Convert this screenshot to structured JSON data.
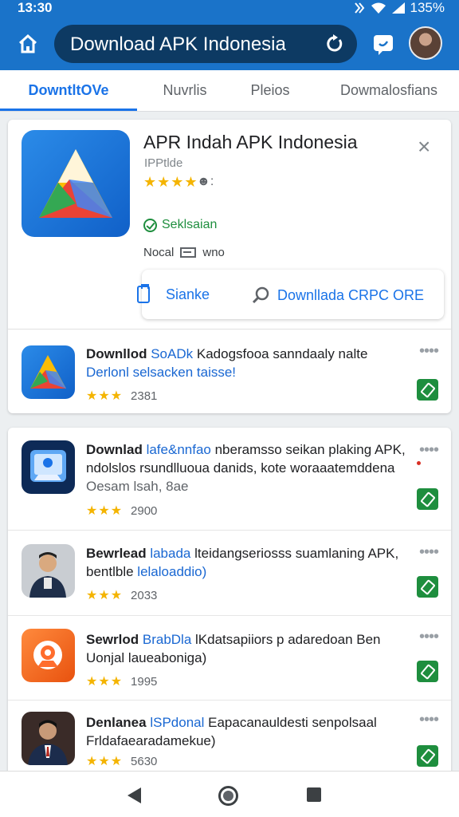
{
  "status_bar": {
    "time": "13:30",
    "battery": "135%"
  },
  "app_bar": {
    "search_text": "Download APK Indonesia"
  },
  "tabs": [
    {
      "label": "DowntltOVe",
      "active": true
    },
    {
      "label": "Nuvrlis",
      "active": false
    },
    {
      "label": "Pleios",
      "active": false
    },
    {
      "label": "Dowmalosfians",
      "active": false
    }
  ],
  "featured": {
    "title": "APR Indah APK Indonesia",
    "subtitle": "IPPtlde",
    "stars": "★★★★",
    "status": "Seklsaian",
    "meta_label": "Nocal",
    "meta_value": "wno",
    "action_left": "Sianke",
    "action_right": "Downllada CRPC ORE"
  },
  "apps": [
    {
      "title_bold": "Downllod",
      "title_blue": "SoADk",
      "title_rest": " Kadogsfooa sanndaaly nalte",
      "line2_blue": "Derlonl selsacken taisse!",
      "line3": "",
      "stars": "★★★",
      "count": "2381",
      "icon": "gradient-triangle-icon"
    },
    {
      "title_bold": "Downlad",
      "title_blue": "lafe&nnfao",
      "title_rest": " nberamsso seikan plaking APK, ndolslos rsundlluoua danids, kote woraaatemddena",
      "line2_blue": "",
      "line3": "Oesam lsah, 8ae",
      "stars": "★★★",
      "count": "2900",
      "icon": "phone-app-icon"
    },
    {
      "title_bold": "Bewrlead",
      "title_blue": "labada",
      "title_rest": " lteidangseriosss suamlaning APK, bentlble",
      "line2_blue": "lelaloaddio)",
      "line3": "",
      "stars": "★★★",
      "count": "2033",
      "icon": "person-icon"
    },
    {
      "title_bold": "Sewrlod",
      "title_blue": "BrabDla",
      "title_rest": " lKdatsapiiors p adaredoan Ben Uonjal laueaboniga)",
      "line2_blue": "",
      "line3": "",
      "stars": "★★★",
      "count": "1995",
      "icon": "robot-icon"
    },
    {
      "title_bold": "Denlanea",
      "title_blue": "lSPdonal",
      "title_rest": " Eapacanauldesti senpolsaal Frldafaearadamekue)",
      "line2_blue": "",
      "line3": "",
      "stars": "★★★",
      "count": "5630",
      "icon": "person-suit-icon"
    }
  ],
  "colors": {
    "app_bar": "#1a73c9",
    "accent": "#1a73e8",
    "green": "#1e8e3e",
    "star": "#f4b400"
  }
}
